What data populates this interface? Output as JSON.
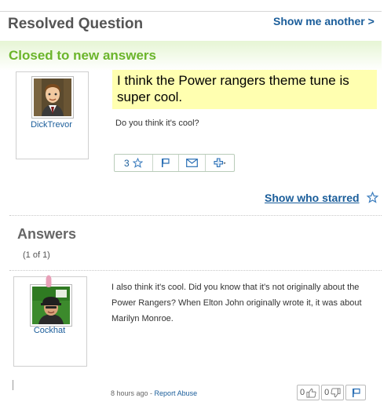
{
  "header": {
    "title": "Resolved Question",
    "show_another": "Show me another >"
  },
  "status": "Closed to new answers",
  "question": {
    "asker": "DickTrevor",
    "title": "I think the Power rangers theme tune is super cool.",
    "body": "Do you think it's cool?",
    "star_count": "3",
    "show_who_starred": "Show who starred"
  },
  "answers": {
    "title": "Answers",
    "count": "(1 of 1)",
    "items": [
      {
        "author": "Cockhat",
        "text": "I also think it's cool. Did you know that it's not originally about the Power Rangers? When Elton John originally wrote it, it was about Marilyn Monroe.",
        "time": "8 hours ago",
        "separator": " - ",
        "report": "Report Abuse",
        "thumbs_up": "0",
        "thumbs_down": "0"
      }
    ]
  },
  "colors": {
    "link": "#1a5d9a",
    "status_green": "#6bb52b",
    "highlight": "#ffffb0"
  },
  "icons": [
    "star-icon",
    "flag-icon",
    "envelope-icon",
    "plus-icon",
    "thumbs-up-icon",
    "thumbs-down-icon"
  ]
}
